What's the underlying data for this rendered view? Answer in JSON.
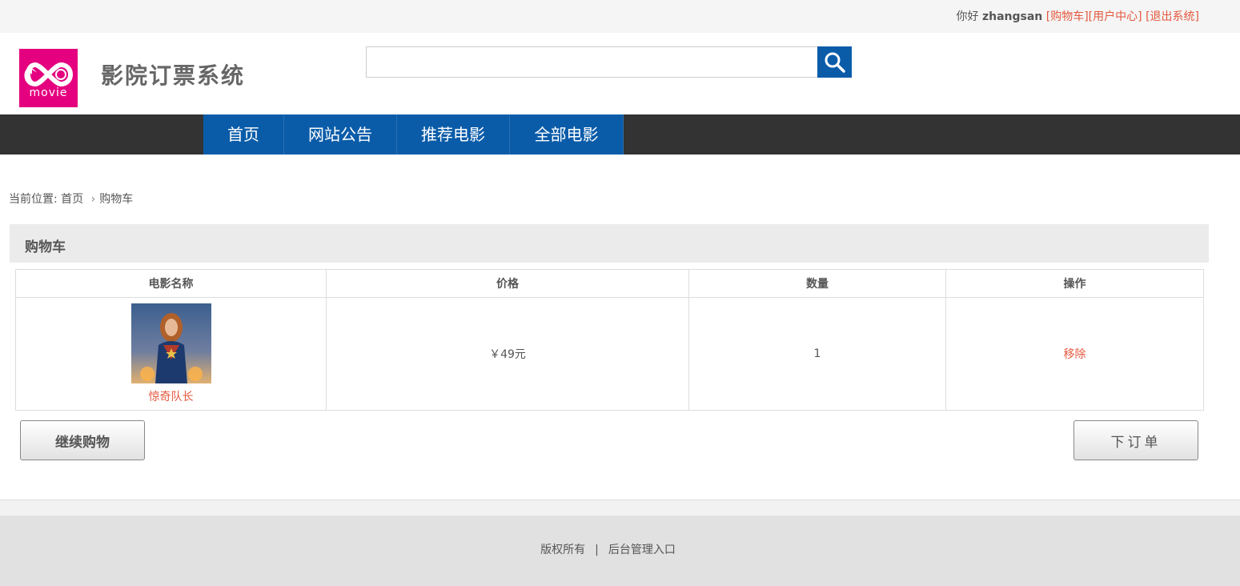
{
  "topbar": {
    "greeting": "你好",
    "username": "zhangsan",
    "cart_link": "[购物车]",
    "user_center_link": "[用户中心]",
    "logout_link": "[退出系统]"
  },
  "header": {
    "logo_text": "movie",
    "site_title": "影院订票系统",
    "search_placeholder": ""
  },
  "nav": {
    "items": [
      {
        "label": "首页"
      },
      {
        "label": "网站公告"
      },
      {
        "label": "推荐电影"
      },
      {
        "label": "全部电影"
      }
    ]
  },
  "breadcrumb": {
    "prefix": "当前位置:",
    "home": "首页",
    "current": "购物车"
  },
  "cart": {
    "title": "购物车",
    "columns": [
      "电影名称",
      "价格",
      "数量",
      "操作"
    ],
    "rows": [
      {
        "movie_name": "惊奇队长",
        "price": "￥49元",
        "quantity": "1",
        "action": "移除"
      }
    ]
  },
  "buttons": {
    "continue_shopping": "继续购物",
    "place_order": "下订单"
  },
  "footer": {
    "copyright": "版权所有",
    "separator": "|",
    "admin_link": "后台管理入口"
  },
  "colors": {
    "brand_blue": "#0a5ca9",
    "logo_pink": "#e4007f",
    "link_red": "#e4583e",
    "nav_dark": "#333333"
  }
}
